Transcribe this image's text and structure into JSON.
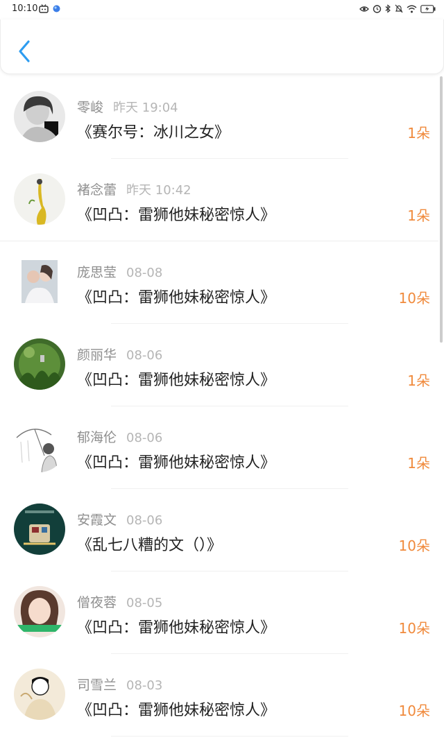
{
  "status": {
    "time": "10:10"
  },
  "colors": {
    "accent_back": "#2d9cf0",
    "gift": "#f08a3c",
    "name": "#8f8f8f",
    "time": "#b5b5b5",
    "title": "#222222"
  },
  "header": {
    "back_icon": "chevron-left-icon"
  },
  "rows": [
    {
      "name": "零峻",
      "time": "昨天 19:04",
      "book": "《赛尔号：冰川之女》",
      "gift": "1朵"
    },
    {
      "name": "褚念蕾",
      "time": "昨天 10:42",
      "book": "《凹凸：雷狮他妹秘密惊人》",
      "gift": "1朵"
    },
    {
      "name": "庞思莹",
      "time": "08-08",
      "book": "《凹凸：雷狮他妹秘密惊人》",
      "gift": "10朵"
    },
    {
      "name": "颜丽华",
      "time": "08-06",
      "book": "《凹凸：雷狮他妹秘密惊人》",
      "gift": "1朵"
    },
    {
      "name": "郁海伦",
      "time": "08-06",
      "book": "《凹凸：雷狮他妹秘密惊人》",
      "gift": "1朵"
    },
    {
      "name": "安霞文",
      "time": "08-06",
      "book": "《乱七八糟的文（）》",
      "gift": "10朵"
    },
    {
      "name": "僧夜蓉",
      "time": "08-05",
      "book": "《凹凸：雷狮他妹秘密惊人》",
      "gift": "10朵"
    },
    {
      "name": "司雪兰",
      "time": "08-03",
      "book": "《凹凸：雷狮他妹秘密惊人》",
      "gift": "10朵"
    }
  ]
}
